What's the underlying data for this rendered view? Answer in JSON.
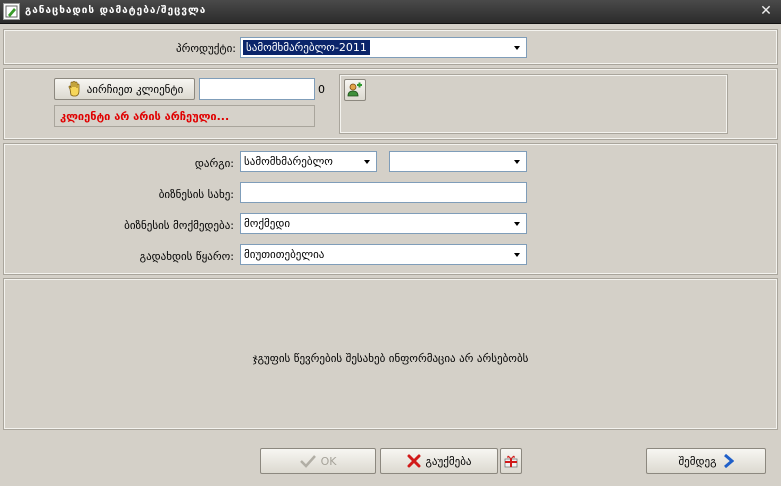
{
  "window": {
    "title": "განაცხადის დამატება/შეცვლა",
    "title_icon": "edit-green-icon",
    "close_glyph": "✕"
  },
  "product": {
    "label": "პროდუქტი:",
    "value": "სამომხმარებლო-2011"
  },
  "client": {
    "choose_button_label": "აირჩიეთ კლიენტი",
    "choose_button_icon": "hand-icon",
    "id_value": "",
    "count": "0",
    "add_button_icon": "add-client-icon",
    "status_text": "კლიენტი არ არის არჩეული...",
    "status_color": "#e00000"
  },
  "form": {
    "category_label": "დარგი:",
    "category_value": "სამომხმარებლო",
    "subcategory_value": "",
    "business_name_label": "ბიზნესის სახე:",
    "business_name_value": "",
    "business_activity_label": "ბიზნესის მოქმედება:",
    "business_activity_value": "მოქმედი",
    "repayment_source_label": "გადახდის წყარო:",
    "repayment_source_value": "მიუთითებელია"
  },
  "group_info": {
    "empty_message": "ჯგუფის წევრების შესახებ ინფორმაცია არ არსებობს"
  },
  "footer": {
    "ok_label": "OK",
    "cancel_label": "გაუქმება",
    "next_label": "შემდეგ"
  },
  "colors": {
    "accent_selection": "#0a246a",
    "title_bar": "#2b2b2b"
  }
}
